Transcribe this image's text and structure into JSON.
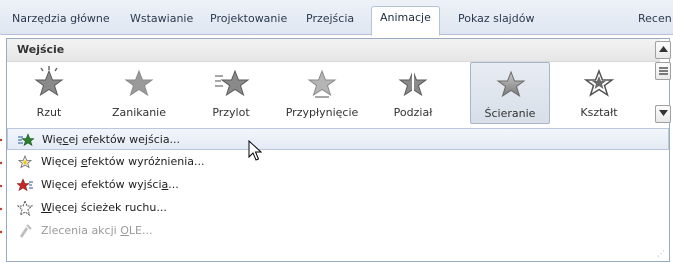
{
  "tabs": [
    {
      "label": "Narzędzia główne"
    },
    {
      "label": "Wstawianie"
    },
    {
      "label": "Projektowanie"
    },
    {
      "label": "Przejścia"
    },
    {
      "label": "Animacje",
      "active": true
    },
    {
      "label": "Pokaz slajdów"
    },
    {
      "label": "Recen"
    }
  ],
  "gallery": {
    "header": "Wejście",
    "effects": [
      {
        "label": "Rzut",
        "icon": "star-fly-icon"
      },
      {
        "label": "Zanikanie",
        "icon": "star-fade-icon"
      },
      {
        "label": "Przylot",
        "icon": "star-fly-in-icon"
      },
      {
        "label": "Przypłynięcie",
        "icon": "star-float-icon"
      },
      {
        "label": "Podział",
        "icon": "star-split-icon"
      },
      {
        "label": "Ścieranie",
        "icon": "star-wipe-icon",
        "selected": true
      },
      {
        "label": "Kształt",
        "icon": "star-shape-icon"
      }
    ]
  },
  "menu": {
    "items": [
      {
        "pre": "Wię",
        "ul": "c",
        "post": "ej efektów wejścia...",
        "icon": "entrance-effects-icon",
        "state": "hover"
      },
      {
        "pre": "Więcej ",
        "ul": "e",
        "post": "fektów wyróżnienia...",
        "icon": "emphasis-effects-icon",
        "state": "normal"
      },
      {
        "pre": "Więcej efektów wyjści",
        "ul": "a",
        "post": "...",
        "icon": "exit-effects-icon",
        "state": "normal"
      },
      {
        "pre": "",
        "ul": "W",
        "post": "ięcej ścieżek ruchu...",
        "icon": "motion-paths-icon",
        "state": "normal"
      },
      {
        "pre": "Zlecenia akcji ",
        "ul": "O",
        "post": "LE...",
        "icon": "ole-actions-icon",
        "state": "disabled"
      }
    ]
  },
  "colors": {
    "star_gray": "#8a8a8a",
    "star_dark": "#555555",
    "accent_blue": "#4a79b5",
    "left_marker": "#c0392b"
  }
}
